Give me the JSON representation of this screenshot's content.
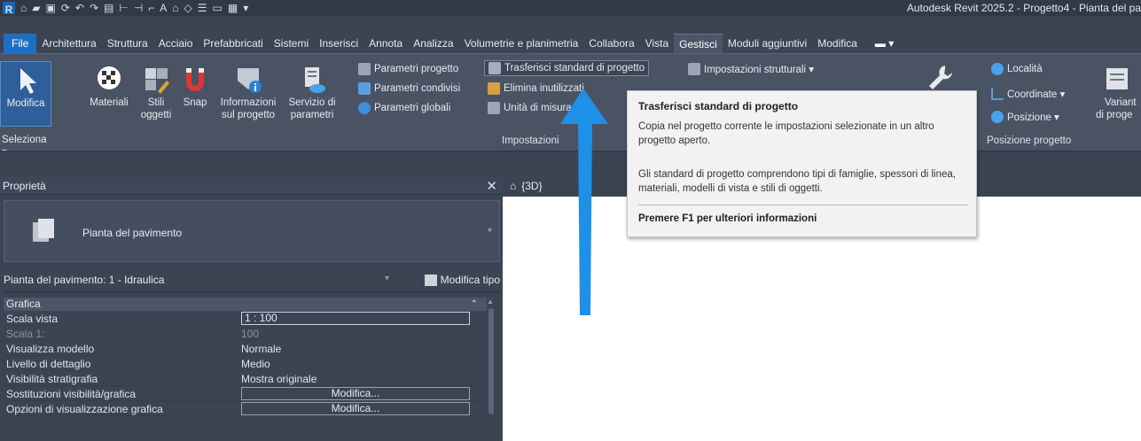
{
  "window": {
    "title": "Autodesk Revit 2025.2 - Progetto4 - Pianta del pa"
  },
  "menu": {
    "file": "File",
    "tabs": [
      "Architettura",
      "Struttura",
      "Acciaio",
      "Prefabbricati",
      "Sistemi",
      "Inserisci",
      "Annota",
      "Analizza",
      "Volumetrie e planimetria",
      "Collabora",
      "Vista",
      "Gestisci",
      "Moduli aggiuntivi",
      "Modifica"
    ],
    "active": "Gestisci"
  },
  "ribbon": {
    "modifica": "Modifica",
    "seleziona": "Seleziona ▾",
    "materiali": "Materiali",
    "stili_l1": "Stili",
    "stili_l2": "oggetti",
    "snap": "Snap",
    "info_l1": "Informazioni",
    "info_l2": "sul progetto",
    "servizio_l1": "Servizio di",
    "servizio_l2": "parametri",
    "parametri_progetto": "Parametri progetto",
    "parametri_condivisi": "Parametri condivisi",
    "parametri_globali": "Parametri globali",
    "trasferisci": "Trasferisci standard di progetto",
    "elimina": "Elimina inutilizzati",
    "unita": "Unità di misura",
    "impostazioni_strutturali": "Impostazioni strutturali ▾",
    "impostazioni_panel": "Impostazioni",
    "localita": "Località",
    "coordinate": "Coordinate ▾",
    "posizione": "Posizione ▾",
    "posizione_panel": "Posizione progetto",
    "varianti_l1": "Variant",
    "varianti_l2": "di proge"
  },
  "tooltip": {
    "title": "Trasferisci standard di progetto",
    "desc": "Copia nel progetto corrente le impostazioni selezionate in un altro progetto aperto.",
    "detail": "Gli standard di progetto comprendono tipi di famiglie, spessori di linea, materiali, modelli di vista e stili di oggetti.",
    "help": "Premere F1 per ulteriori informazioni"
  },
  "properties": {
    "title": "Proprietà",
    "close": "✕",
    "type_name": "Pianta del pavimento",
    "instance": "Pianta del pavimento: 1 - Idraulica",
    "modifica_tipo": "Modifica tipo",
    "section": "Grafica",
    "rows": [
      {
        "k": "Scala vista",
        "v": "1 : 100"
      },
      {
        "k": "Scala 1:",
        "v": "100"
      },
      {
        "k": "Visualizza modello",
        "v": "Normale"
      },
      {
        "k": "Livello di dettaglio",
        "v": "Medio"
      },
      {
        "k": "Visibilità stratigrafia",
        "v": "Mostra originale"
      },
      {
        "k": "Sostituzioni visibilità/grafica",
        "v": "Modifica..."
      },
      {
        "k": "Opzioni di visualizzazione grafica",
        "v": "Modifica..."
      }
    ]
  },
  "views": {
    "tab3d": "{3D}"
  },
  "colors": {
    "accent": "#1e6fc4",
    "arrow": "#1e90e8",
    "ribbon": "#4a5364",
    "background": "#3b4453"
  }
}
